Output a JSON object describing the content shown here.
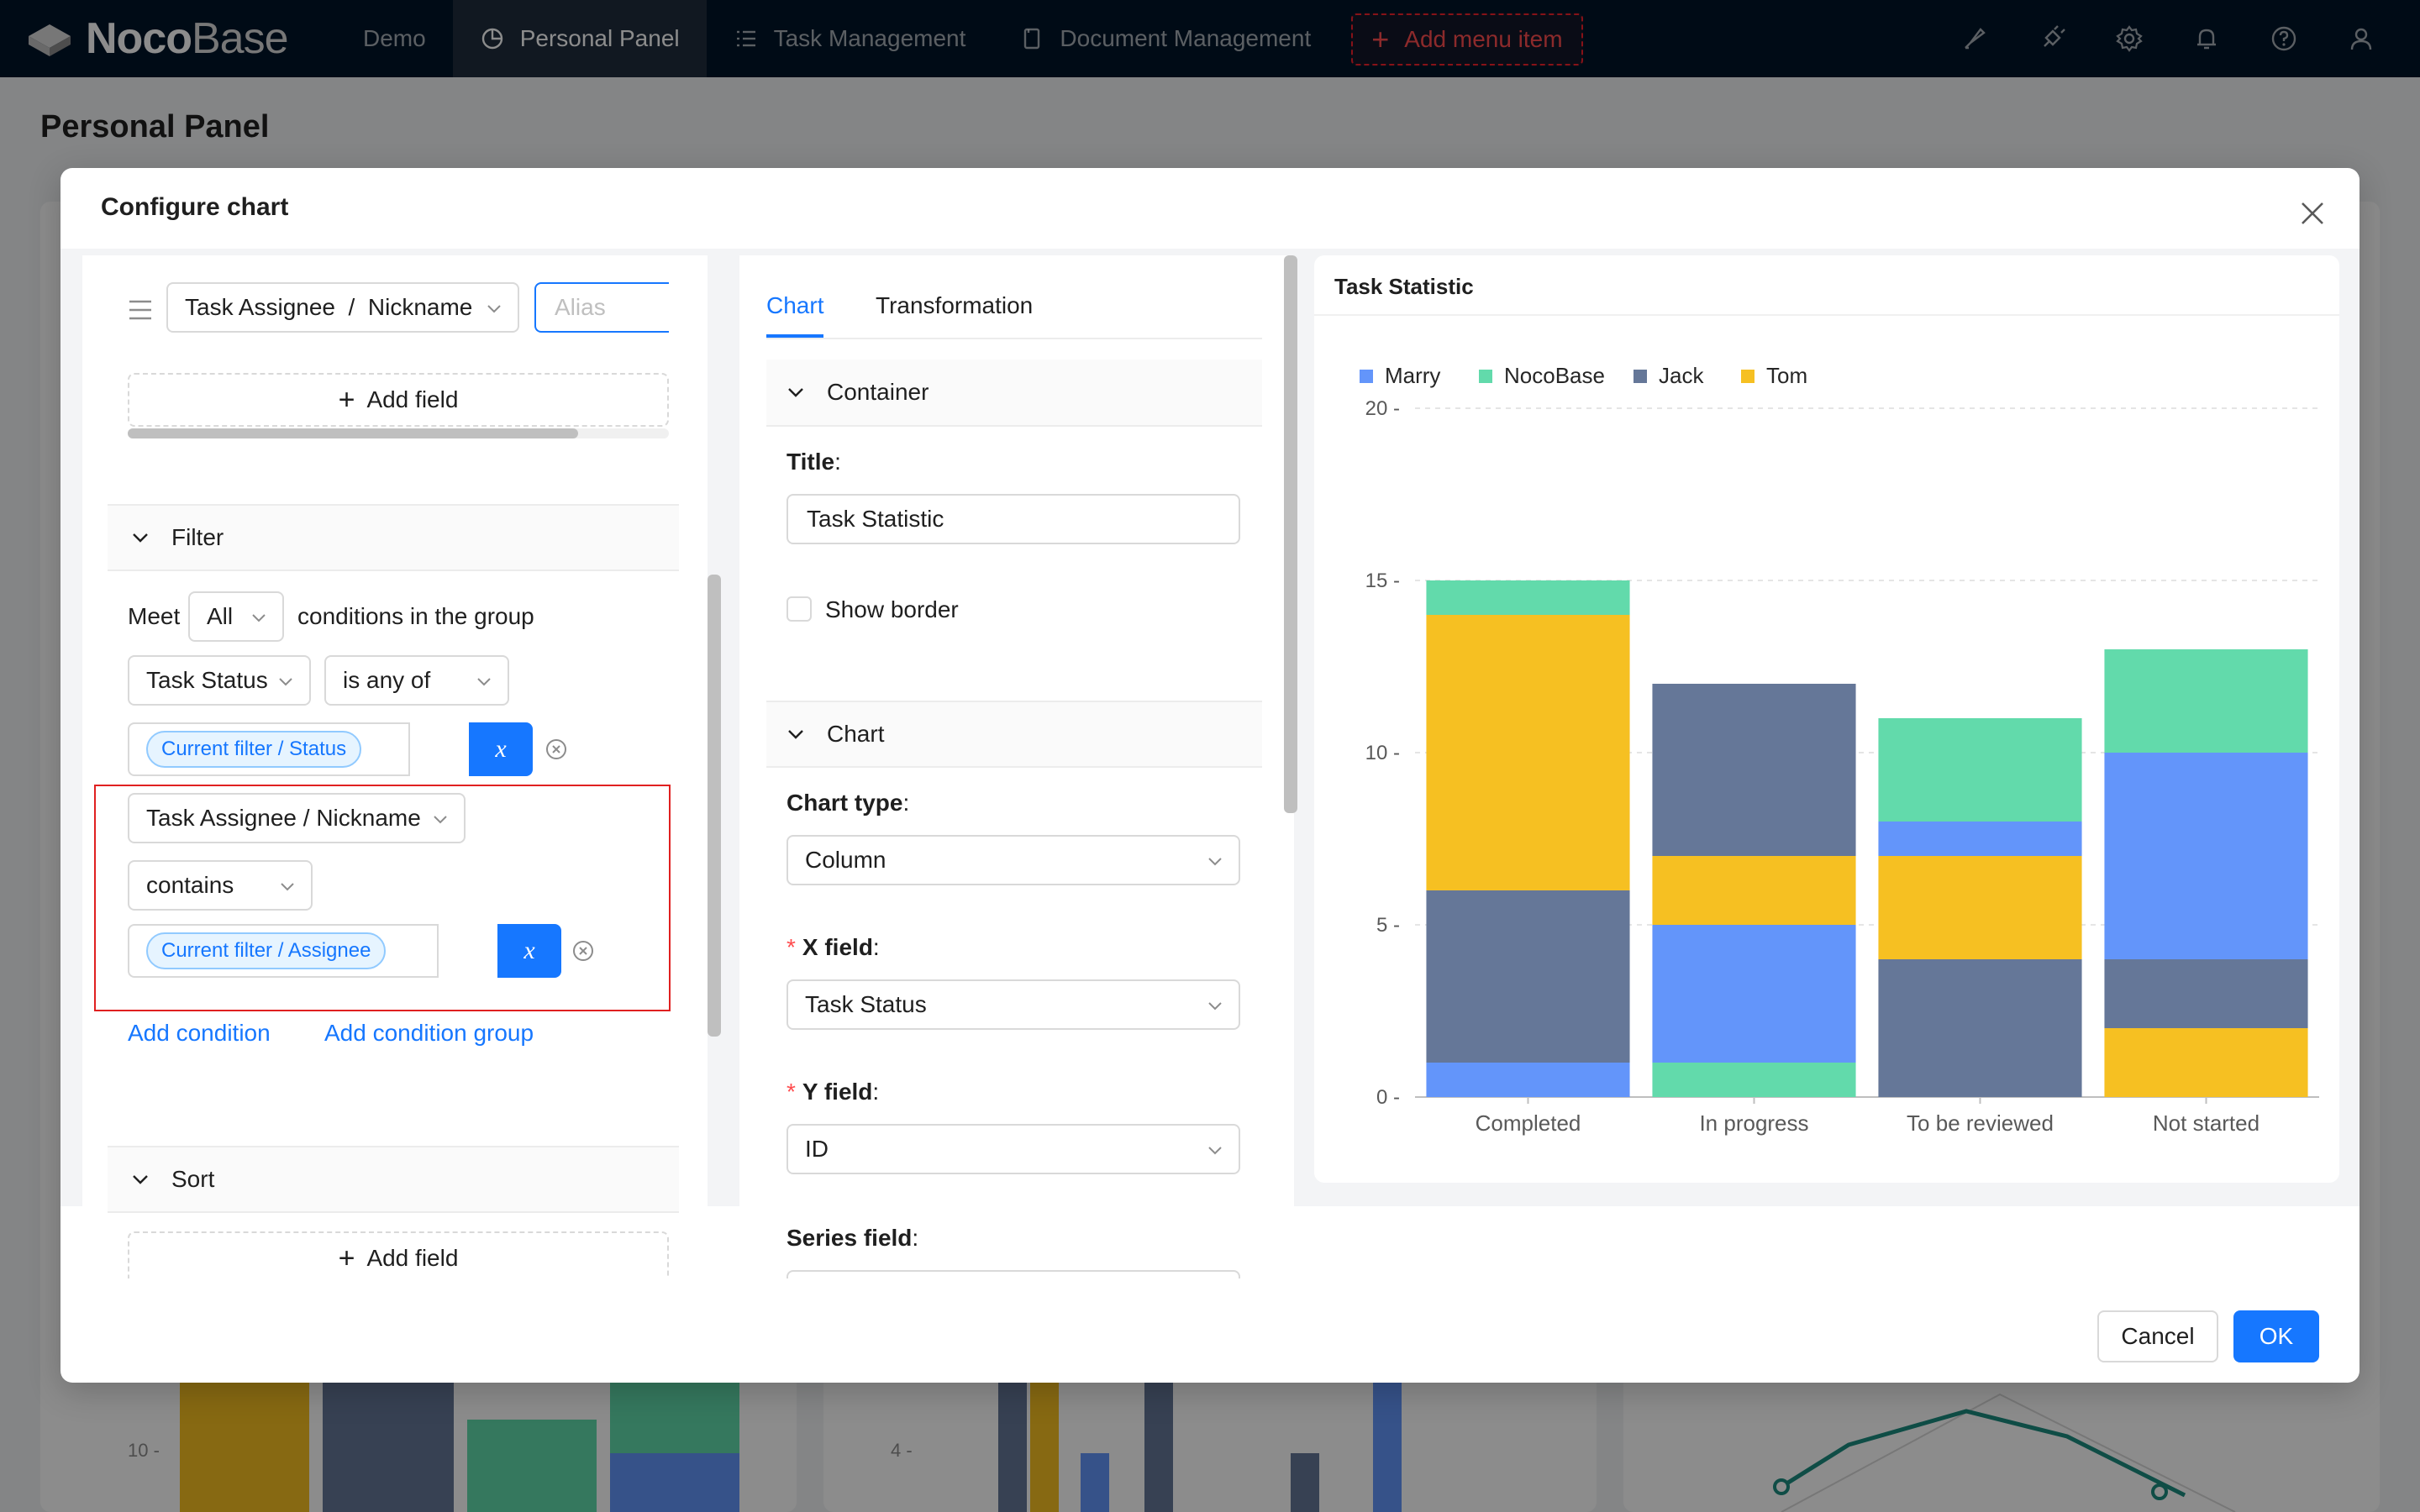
{
  "nav": {
    "brand": "Noco",
    "brand_light": "Base",
    "items": [
      {
        "label": "Demo",
        "icon": "",
        "active": false
      },
      {
        "label": "Personal Panel",
        "icon": "pie-chart-icon",
        "active": true
      },
      {
        "label": "Task Management",
        "icon": "list-icon",
        "active": false
      },
      {
        "label": "Document Management",
        "icon": "document-icon",
        "active": false
      }
    ],
    "add_menu_item": "Add menu item",
    "right_icons": [
      "paint-brush-icon",
      "plugin-icon",
      "gear-icon",
      "bell-icon",
      "help-icon",
      "user-icon"
    ]
  },
  "page": {
    "title": "Personal Panel",
    "bg_tick_left": "10 -",
    "bg_tick_mid": "4 -"
  },
  "modal": {
    "title": "Configure chart",
    "cancel": "Cancel",
    "ok": "OK"
  },
  "query": {
    "measure_field": "Task Assignee  /  Nickname",
    "alias_placeholder": "Alias",
    "add_field": "Add field",
    "filter": {
      "title": "Filter",
      "meet": "Meet",
      "logic": "All",
      "suffix": "conditions in the group",
      "conditions": [
        {
          "field": "Task Status",
          "operator": "is any of",
          "value": "Current filter / Status"
        },
        {
          "field": "Task Assignee / Nickname",
          "operator": "contains",
          "value": "Current filter / Assignee"
        }
      ],
      "variable_symbol": "x",
      "add_condition": "Add condition",
      "add_condition_group": "Add condition group"
    },
    "sort": {
      "title": "Sort",
      "add_field": "Add field"
    }
  },
  "config": {
    "tabs": [
      "Chart",
      "Transformation"
    ],
    "container": {
      "title": "Container",
      "title_label": "Title",
      "title_value": "Task Statistic",
      "show_border": "Show border"
    },
    "chart": {
      "title": "Chart",
      "chart_type_label": "Chart type",
      "chart_type": "Column",
      "x_field_label": "X field",
      "x_field": "Task Status",
      "y_field_label": "Y field",
      "y_field": "ID",
      "series_field_label": "Series field"
    },
    "colon": ":",
    "required": "*"
  },
  "preview": {
    "title": "Task Statistic"
  },
  "chart_data": {
    "type": "bar",
    "stacked": true,
    "title": "Task Statistic",
    "categories": [
      "Completed",
      "In progress",
      "To be reviewed",
      "Not started"
    ],
    "series": [
      {
        "name": "Marry",
        "color": "#6395fa",
        "values": [
          1,
          4,
          1,
          6
        ]
      },
      {
        "name": "NocoBase",
        "color": "#62daab",
        "values": [
          1,
          1,
          3,
          3
        ]
      },
      {
        "name": "Jack",
        "color": "#657798",
        "values": [
          5,
          5,
          4,
          2
        ]
      },
      {
        "name": "Tom",
        "color": "#f6c022",
        "values": [
          8,
          2,
          3,
          2
        ]
      }
    ],
    "stack_order_bottom_to_top": [
      [
        "Marry",
        "Jack",
        "Tom",
        "NocoBase"
      ],
      [
        "NocoBase",
        "Marry",
        "Tom",
        "Jack"
      ],
      [
        "Jack",
        "Tom",
        "Marry",
        "NocoBase"
      ],
      [
        "Tom",
        "Jack",
        "Marry",
        "NocoBase"
      ]
    ],
    "yticks": [
      0,
      5,
      10,
      15,
      20
    ],
    "ylim": [
      0,
      20
    ],
    "grid": true,
    "legend": "top-left"
  }
}
